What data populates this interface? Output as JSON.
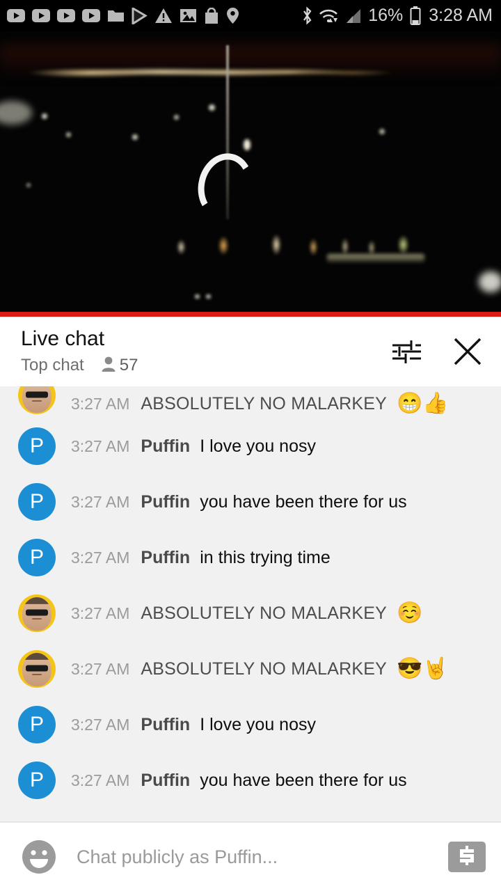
{
  "statusbar": {
    "left_icons": [
      "youtube-icon",
      "youtube-icon",
      "youtube-icon",
      "youtube-icon",
      "folder-icon",
      "play-store-icon",
      "warning-triangle-icon",
      "image-icon",
      "shopping-bag-icon",
      "location-pin-icon"
    ],
    "right_icons": [
      "bluetooth-icon",
      "wifi-icon",
      "cell-signal-icon",
      "battery-icon"
    ],
    "battery_percent": "16%",
    "clock": "3:28 AM"
  },
  "video": {
    "state": "loading",
    "spinner": "loading-spinner",
    "progress_color": "#e01b15",
    "scene": "night city skyline"
  },
  "chat_header": {
    "title": "Live chat",
    "mode": "Top chat",
    "viewer_icon": "person-icon",
    "viewer_count": "57",
    "settings_icon": "chat-settings-sliders-icon",
    "close_icon": "close-icon"
  },
  "messages": [
    {
      "avatar_type": "photo",
      "avatar_letter": "",
      "time": "3:27 AM",
      "author": "ABSOLUTELY NO MALARKEY",
      "author_caps": true,
      "text": "",
      "emoji": "😁👍",
      "clipped": true
    },
    {
      "avatar_type": "letter",
      "avatar_letter": "P",
      "time": "3:27 AM",
      "author": "Puffin",
      "author_caps": false,
      "text": "I love you nosy",
      "emoji": "",
      "clipped": false
    },
    {
      "avatar_type": "letter",
      "avatar_letter": "P",
      "time": "3:27 AM",
      "author": "Puffin",
      "author_caps": false,
      "text": "you have been there for us",
      "emoji": "",
      "clipped": false
    },
    {
      "avatar_type": "letter",
      "avatar_letter": "P",
      "time": "3:27 AM",
      "author": "Puffin",
      "author_caps": false,
      "text": "in this trying time",
      "emoji": "",
      "clipped": false
    },
    {
      "avatar_type": "photo",
      "avatar_letter": "",
      "time": "3:27 AM",
      "author": "ABSOLUTELY NO MALARKEY",
      "author_caps": true,
      "text": "",
      "emoji": "☺️",
      "clipped": false
    },
    {
      "avatar_type": "photo",
      "avatar_letter": "",
      "time": "3:27 AM",
      "author": "ABSOLUTELY NO MALARKEY",
      "author_caps": true,
      "text": "",
      "emoji": "😎🤘",
      "clipped": false
    },
    {
      "avatar_type": "letter",
      "avatar_letter": "P",
      "time": "3:27 AM",
      "author": "Puffin",
      "author_caps": false,
      "text": "I love you nosy",
      "emoji": "",
      "clipped": false
    },
    {
      "avatar_type": "letter",
      "avatar_letter": "P",
      "time": "3:27 AM",
      "author": "Puffin",
      "author_caps": false,
      "text": "you have been there for us",
      "emoji": "",
      "clipped": false
    }
  ],
  "input_bar": {
    "emoji_icon": "emoji-smiley-icon",
    "placeholder": "Chat publicly as Puffin...",
    "value": "",
    "superchat_icon": "dollar-sign-icon"
  },
  "colors": {
    "accent_red": "#e01b15",
    "avatar_blue": "#1b8ed4",
    "avatar_yellow": "#f5c418",
    "chat_bg": "#f1f1f1"
  }
}
